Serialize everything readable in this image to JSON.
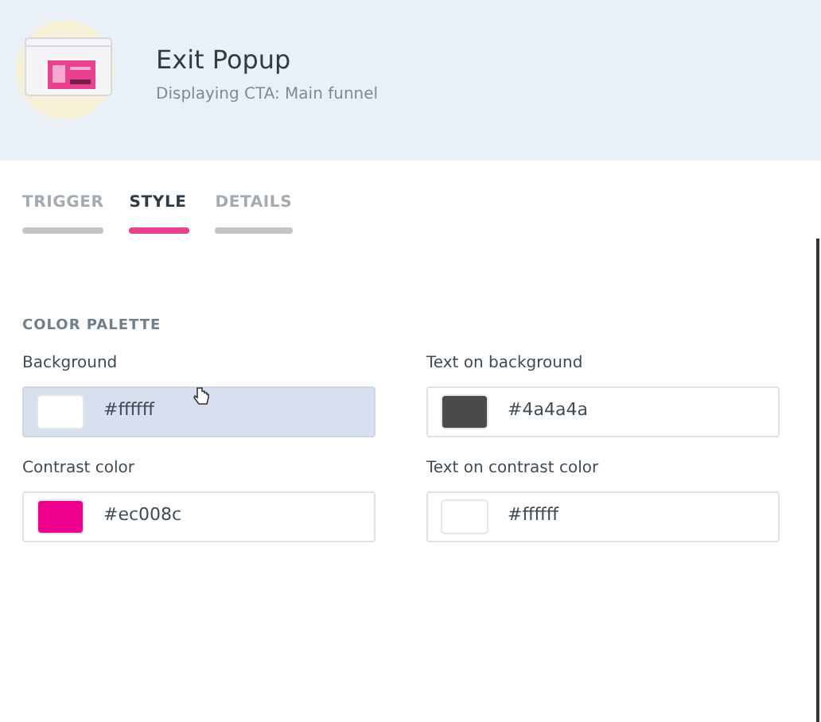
{
  "header": {
    "title": "Exit Popup",
    "subtitle": "Displaying CTA:  Main funnel"
  },
  "tabs": [
    {
      "label": "TRIGGER",
      "selected": false
    },
    {
      "label": "STYLE",
      "selected": true
    },
    {
      "label": "DETAILS",
      "selected": false
    }
  ],
  "section_title": "COLOR PALETTE",
  "colors": [
    {
      "label": "Background",
      "value": "#ffffff",
      "color": "#ffffff",
      "hovered": true
    },
    {
      "label": "Text on background",
      "value": "#4a4a4a",
      "color": "#4a4a4a",
      "hovered": false
    },
    {
      "label": "Contrast color",
      "value": "#ec008c",
      "color": "#ec008c",
      "hovered": false
    },
    {
      "label": "Text on contrast color",
      "value": "#ffffff",
      "color": "#ffffff",
      "hovered": false
    }
  ]
}
